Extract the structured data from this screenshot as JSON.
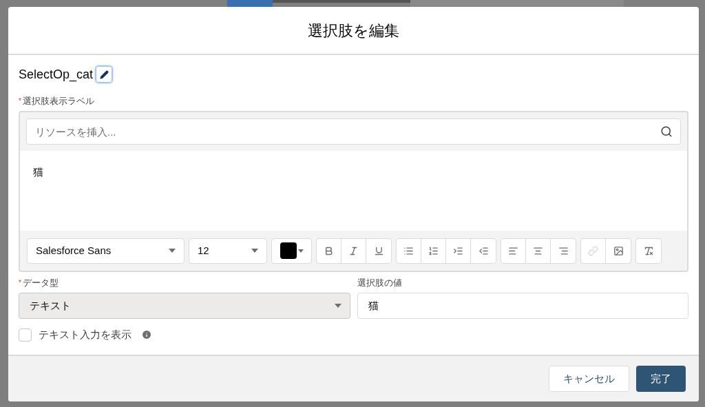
{
  "dialog": {
    "title": "選択肢を編集",
    "api_name": "SelectOp_cat",
    "label_field": {
      "label": "選択肢表示ラベル",
      "required_mark": "*",
      "resource_search": {
        "placeholder": "リソースを挿入..."
      },
      "content": "猫",
      "toolbar": {
        "font": "Salesforce Sans",
        "size": "12",
        "text_color": {
          "color": "#000000"
        },
        "groups": [
          [
            {
              "kind": "bold",
              "disabled": false
            },
            {
              "kind": "italic",
              "disabled": false
            },
            {
              "kind": "underline",
              "disabled": false
            }
          ],
          [
            {
              "kind": "bullets",
              "disabled": false
            },
            {
              "kind": "numbers",
              "disabled": false
            },
            {
              "kind": "indent",
              "disabled": false
            },
            {
              "kind": "outdent",
              "disabled": false
            }
          ],
          [
            {
              "kind": "align-left",
              "disabled": false
            },
            {
              "kind": "align-center",
              "disabled": false
            },
            {
              "kind": "align-right",
              "disabled": false
            }
          ],
          [
            {
              "kind": "link",
              "disabled": true
            },
            {
              "kind": "image",
              "disabled": false
            }
          ],
          [
            {
              "kind": "clear",
              "disabled": false
            }
          ]
        ]
      }
    },
    "data_type": {
      "label": "データ型",
      "required_mark": "*",
      "value": "テキスト"
    },
    "choice_value": {
      "label": "選択肢の値",
      "value": "猫"
    },
    "show_text_input": {
      "label": "テキスト入力を表示",
      "checked": false
    },
    "buttons": [
      {
        "label": "キャンセル",
        "kind": "secondary"
      },
      {
        "label": "完了",
        "kind": "primary"
      }
    ]
  }
}
